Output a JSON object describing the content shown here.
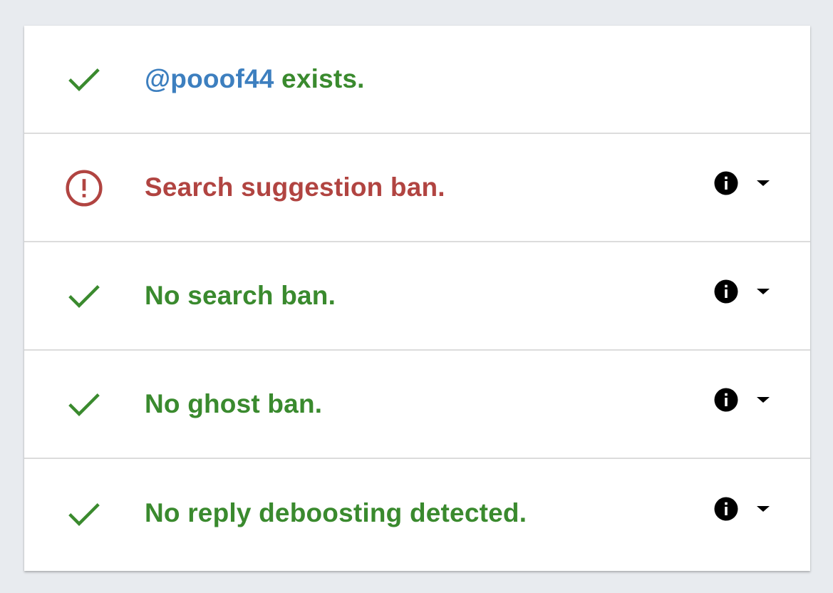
{
  "colors": {
    "success": "#3a8a2e",
    "error": "#b14441",
    "handle": "#3d7fbf",
    "background": "#e8ebef"
  },
  "rows": [
    {
      "status": "ok",
      "icon": "check-icon",
      "handle": "@pooof44",
      "text": " exists.",
      "has_details": false
    },
    {
      "status": "bad",
      "icon": "alert-circle-icon",
      "text": "Search suggestion ban.",
      "has_details": true
    },
    {
      "status": "ok",
      "icon": "check-icon",
      "text": "No search ban.",
      "has_details": true
    },
    {
      "status": "ok",
      "icon": "check-icon",
      "text": "No ghost ban.",
      "has_details": true
    },
    {
      "status": "ok",
      "icon": "check-icon",
      "text": "No reply deboosting detected.",
      "has_details": true
    }
  ]
}
